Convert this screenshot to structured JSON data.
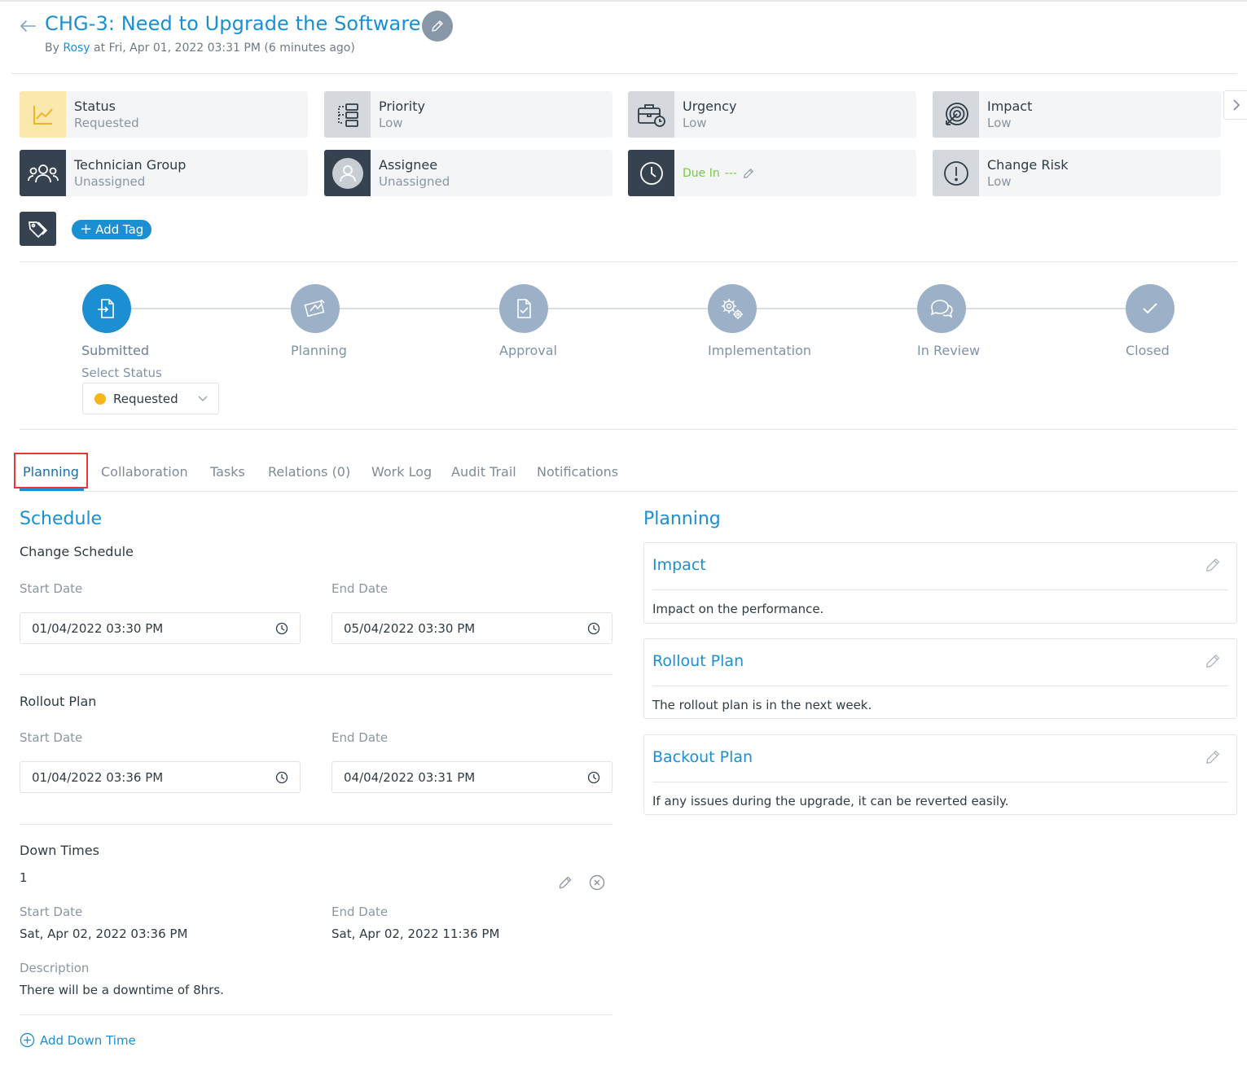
{
  "header": {
    "title": "CHG-3: Need to Upgrade the Software",
    "by_prefix": "By",
    "user": "Rosy",
    "timestamp": "at Fri, Apr 01, 2022 03:31 PM (6 minutes ago)"
  },
  "cards": [
    {
      "label": "Status",
      "value": "Requested",
      "icon": "trend-chart-icon"
    },
    {
      "label": "Priority",
      "value": "Low",
      "icon": "priority-flow-icon"
    },
    {
      "label": "Urgency",
      "value": "Low",
      "icon": "briefcase-clock-icon"
    },
    {
      "label": "Impact",
      "value": "Low",
      "icon": "target-icon"
    },
    {
      "label": "Technician Group",
      "value": "Unassigned",
      "icon": "group-icon"
    },
    {
      "label": "Assignee",
      "value": "Unassigned",
      "icon": "user-avatar-icon"
    },
    {
      "label": "Due In",
      "value": "---",
      "icon": "clock-icon"
    },
    {
      "label": "Change Risk",
      "value": "Low",
      "icon": "alert-circle-icon"
    }
  ],
  "tags": {
    "add_label": "Add Tag"
  },
  "stages": [
    {
      "label": "Submitted",
      "active": true
    },
    {
      "label": "Planning",
      "active": false
    },
    {
      "label": "Approval",
      "active": false
    },
    {
      "label": "Implementation",
      "active": false
    },
    {
      "label": "In Review",
      "active": false
    },
    {
      "label": "Closed",
      "active": false
    }
  ],
  "status_select": {
    "label": "Select Status",
    "value": "Requested",
    "color": "#f5b71c"
  },
  "tabs": [
    "Planning",
    "Collaboration",
    "Tasks",
    "Relations (0)",
    "Work Log",
    "Audit Trail",
    "Notifications"
  ],
  "schedule": {
    "title": "Schedule",
    "change_schedule": {
      "title": "Change Schedule",
      "start_label": "Start Date",
      "start": "01/04/2022 03:30 PM",
      "end_label": "End Date",
      "end": "05/04/2022 03:30 PM"
    },
    "rollout": {
      "title": "Rollout Plan",
      "start_label": "Start Date",
      "start": "01/04/2022 03:36 PM",
      "end_label": "End Date",
      "end": "04/04/2022 03:31 PM"
    },
    "downtimes": {
      "title": "Down Times",
      "index": "1",
      "start_label": "Start Date",
      "start": "Sat, Apr 02, 2022 03:36 PM",
      "end_label": "End Date",
      "end": "Sat, Apr 02, 2022 11:36 PM",
      "desc_label": "Description",
      "desc": "There will be a downtime of 8hrs.",
      "add_label": "Add Down Time"
    }
  },
  "planning": {
    "title": "Planning",
    "items": [
      {
        "title": "Impact",
        "text": "Impact on the performance."
      },
      {
        "title": "Rollout Plan",
        "text": "The rollout plan is in the next week."
      },
      {
        "title": "Backout Plan",
        "text": "If any issues during the upgrade, it can be reverted easily."
      }
    ]
  },
  "colors": {
    "accent": "#1b8fd1",
    "dark": "#364250",
    "stage_inactive": "#9cb0c8",
    "due": "#7cc642",
    "highlight": "#e53935"
  }
}
